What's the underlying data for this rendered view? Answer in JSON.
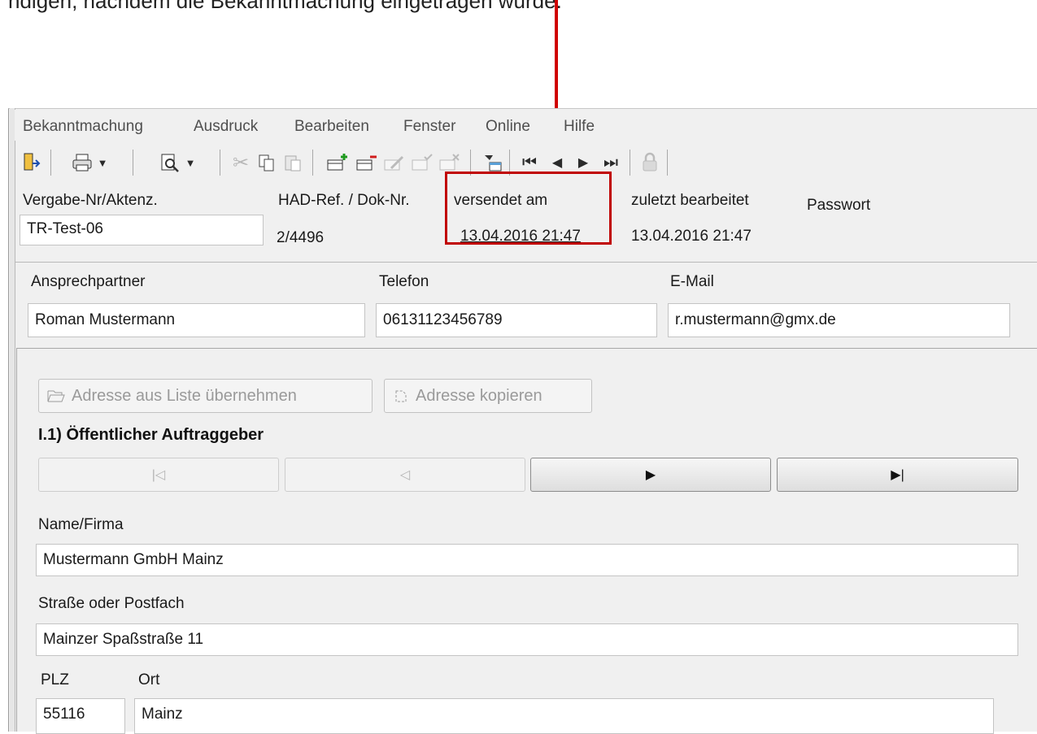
{
  "caption": "ndigen, nachdem die Bekanntmachung eingetragen wurde.",
  "menu": [
    "Bekanntmachung",
    "Ausdruck",
    "Bearbeiten",
    "Fenster",
    "Online",
    "Hilfe"
  ],
  "toolbar_icons": [
    "exit-icon",
    "print-icon",
    "preview-icon",
    "cut-icon",
    "copy-icon",
    "paste-icon",
    "add-record-icon",
    "delete-record-icon",
    "edit-record-icon",
    "confirm-record-icon",
    "cancel-record-icon",
    "filter-icon",
    "first-record-icon",
    "previous-record-icon",
    "next-record-icon",
    "last-record-icon",
    "lock-icon"
  ],
  "header": {
    "vergabe_label": "Vergabe-Nr/Aktenz.",
    "vergabe_value": "TR-Test-06",
    "had_label": "HAD-Ref. / Dok-Nr.",
    "had_value": "2/4496",
    "versendet_label": "versendet am",
    "versendet_value": "13.04.2016 21:47",
    "bearbeitet_label": "zuletzt bearbeitet",
    "bearbeitet_value": "13.04.2016 21:47",
    "passwort_label": "Passwort"
  },
  "contact": {
    "ansprech_label": "Ansprechpartner",
    "ansprech_value": "Roman Mustermann",
    "telefon_label": "Telefon",
    "telefon_value": "06131123456789",
    "email_label": "E-Mail",
    "email_value": "r.mustermann@gmx.de"
  },
  "actions": {
    "adresse_liste": "Adresse aus Liste übernehmen",
    "adresse_kopieren": "Adresse kopieren"
  },
  "section_title": "I.1) Öffentlicher Auftraggeber",
  "address": {
    "name_label": "Name/Firma",
    "name_value": "Mustermann GmbH Mainz",
    "strasse_label": "Straße oder Postfach",
    "strasse_value": "Mainzer Spaßstraße 11",
    "plz_label": "PLZ",
    "plz_value": "55116",
    "ort_label": "Ort",
    "ort_value": "Mainz"
  },
  "colors": {
    "highlight": "#c00000",
    "arrow": "#d00000",
    "window_bg": "#f0f0f0"
  }
}
